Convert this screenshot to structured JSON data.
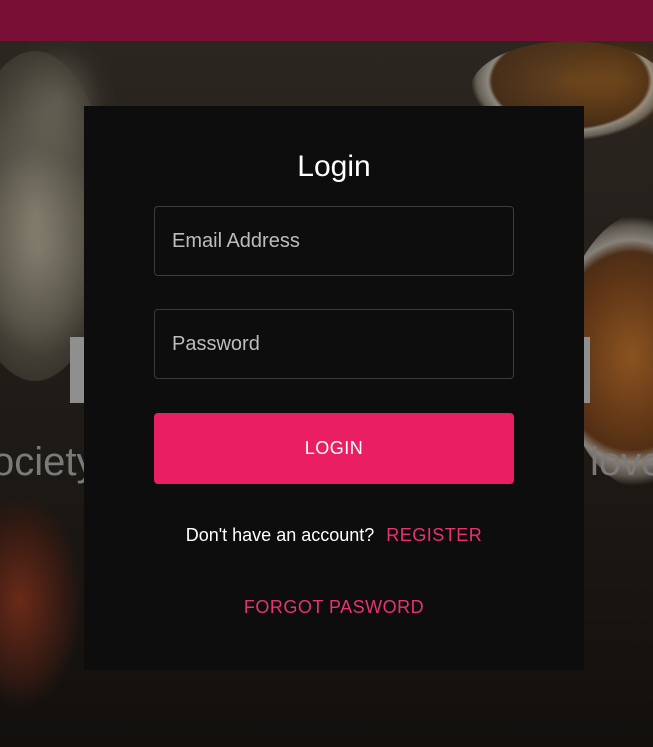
{
  "hero": {
    "subtitle_left": "ociety",
    "subtitle_right": "love"
  },
  "login_form": {
    "title": "Login",
    "email_placeholder": "Email Address",
    "email_value": "",
    "password_placeholder": "Password",
    "password_value": "",
    "submit_label": "LOGIN",
    "register_prompt": "Don't have an account?",
    "register_label": "REGISTER",
    "forgot_label": "FORGOT PASWORD"
  },
  "colors": {
    "topbar": "#7a0f35",
    "accent": "#ea1e63",
    "link": "#e8336e",
    "modal_bg": "#0d0d0d"
  }
}
